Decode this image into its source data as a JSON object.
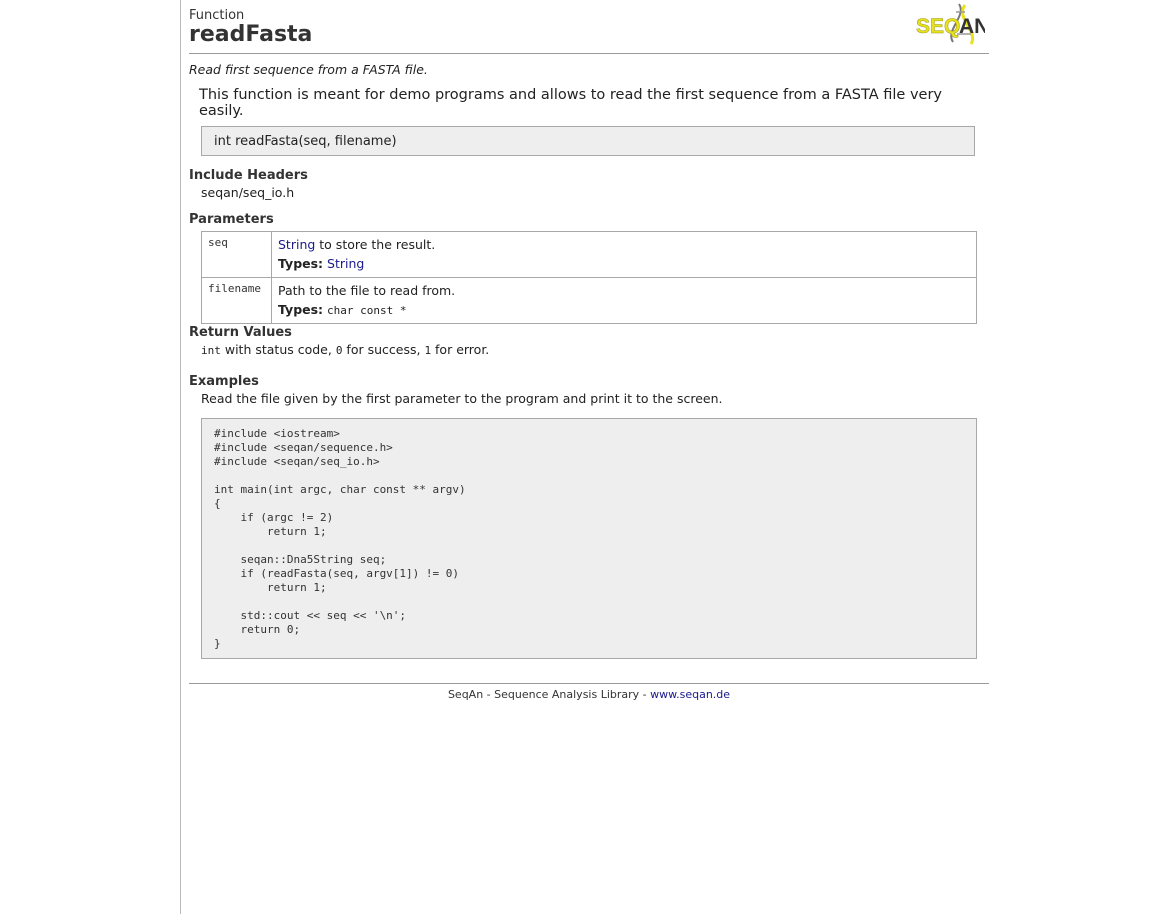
{
  "header": {
    "kind": "Function",
    "title": "readFasta",
    "logo_text": "SEQAN"
  },
  "brief": "Read first sequence from a FASTA file.",
  "description": "This function is meant for demo programs and allows to read the first sequence from a FASTA file very easily.",
  "signature": "int readFasta(seq, filename)",
  "include": {
    "heading": "Include Headers",
    "file": "seqan/seq_io.h"
  },
  "parameters": {
    "heading": "Parameters",
    "types_label": "Types:",
    "rows": [
      {
        "name": "seq",
        "desc_link": "String",
        "desc_rest": " to store the result.",
        "type": "String"
      },
      {
        "name": "filename",
        "desc_link": "",
        "desc_rest": "Path to the file to read from.",
        "type": "char const *"
      }
    ]
  },
  "returns": {
    "heading": "Return Values",
    "code_int": "int",
    "text_1": " with status code, ",
    "code_0": "0",
    "text_2": " for success, ",
    "code_1": "1",
    "text_3": " for error."
  },
  "examples": {
    "heading": "Examples",
    "text": "Read the file given by the first parameter to the program and print it to the screen.",
    "code": "#include <iostream>\n#include <seqan/sequence.h>\n#include <seqan/seq_io.h>\n\nint main(int argc, char const ** argv)\n{\n    if (argc != 2)\n        return 1;\n\n    seqan::Dna5String seq;\n    if (readFasta(seq, argv[1]) != 0)\n        return 1;\n\n    std::cout << seq << '\\n';\n    return 0;\n}"
  },
  "footer": {
    "text": "SeqAn - Sequence Analysis Library - ",
    "link": "www.seqan.de"
  },
  "colors": {
    "link": "#1a1a8a",
    "logo_yellow": "#e8e21c",
    "box_bg": "#eeeeee"
  }
}
